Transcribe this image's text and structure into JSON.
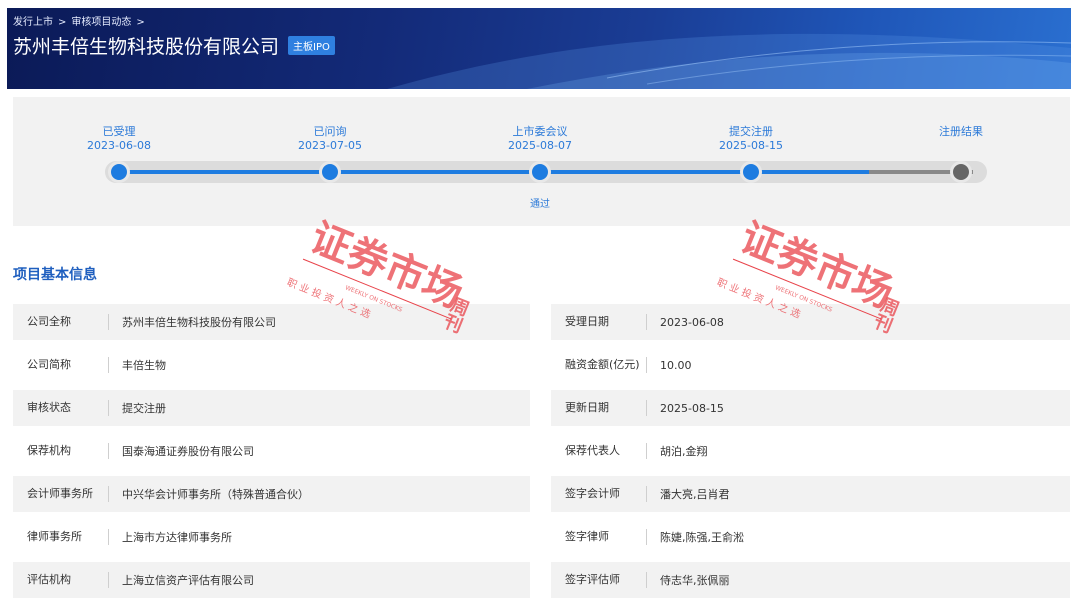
{
  "header": {
    "breadcrumb": [
      "发行上市",
      "审核项目动态"
    ],
    "breadcrumb_sep": ">",
    "title": "苏州丰倍生物科技股份有限公司",
    "badge": "主板IPO"
  },
  "progress": {
    "steps": [
      {
        "label": "已受理",
        "date": "2023-06-08",
        "sub": ""
      },
      {
        "label": "已问询",
        "date": "2023-07-05",
        "sub": ""
      },
      {
        "label": "上市委会议",
        "date": "2025-08-07",
        "sub": "通过"
      },
      {
        "label": "提交注册",
        "date": "2025-08-15",
        "sub": ""
      },
      {
        "label": "注册结果",
        "date": "",
        "sub": ""
      }
    ],
    "completed_steps": 4,
    "active_color": "#1e7ce0",
    "pending_color": "#666666"
  },
  "section": {
    "title": "项目基本信息"
  },
  "info": {
    "left": [
      {
        "label": "公司全称",
        "value": "苏州丰倍生物科技股份有限公司"
      },
      {
        "label": "公司简称",
        "value": "丰倍生物"
      },
      {
        "label": "审核状态",
        "value": "提交注册"
      },
      {
        "label": "保荐机构",
        "value": "国泰海通证券股份有限公司"
      },
      {
        "label": "会计师事务所",
        "value": "中兴华会计师事务所（特殊普通合伙）"
      },
      {
        "label": "律师事务所",
        "value": "上海市方达律师事务所"
      },
      {
        "label": "评估机构",
        "value": "上海立信资产评估有限公司"
      }
    ],
    "right": [
      {
        "label": "受理日期",
        "value": "2023-06-08"
      },
      {
        "label": "融资金额(亿元)",
        "value": "10.00"
      },
      {
        "label": "更新日期",
        "value": "2025-08-15"
      },
      {
        "label": "保荐代表人",
        "value": "胡泊,金翔"
      },
      {
        "label": "签字会计师",
        "value": "潘大亮,吕肖君"
      },
      {
        "label": "签字律师",
        "value": "陈婕,陈强,王俞淞"
      },
      {
        "label": "签字评估师",
        "value": "侍志华,张佩丽"
      }
    ]
  },
  "watermark": {
    "main": "证券市场",
    "side": "周刊",
    "sub": "职 业 投 资 人 之 选",
    "en": "WEEKLY ON STOCKS",
    "color": "#e8434a"
  }
}
